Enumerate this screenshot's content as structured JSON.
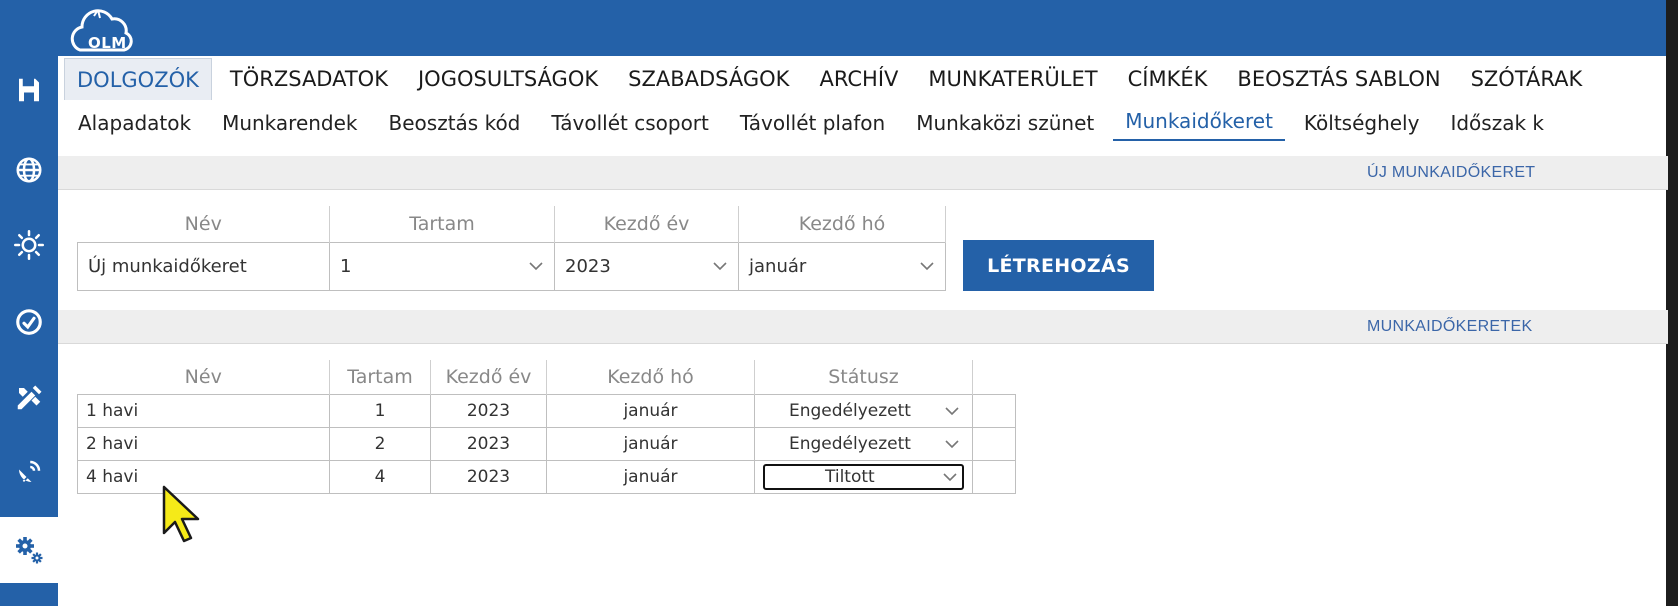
{
  "app": {
    "logo_text": "OLM"
  },
  "sidebar": {
    "items": [
      {
        "icon": "save-icon"
      },
      {
        "icon": "globe-icon"
      },
      {
        "icon": "sun-icon"
      },
      {
        "icon": "clock-icon"
      },
      {
        "icon": "tools-icon"
      },
      {
        "icon": "satellite-dish-icon"
      },
      {
        "icon": "gears-icon",
        "active": true
      }
    ]
  },
  "tabs": [
    {
      "label": "DOLGOZÓK",
      "active": true
    },
    {
      "label": "TÖRZSADATOK"
    },
    {
      "label": "JOGOSULTSÁGOK"
    },
    {
      "label": "SZABADSÁGOK"
    },
    {
      "label": "ARCHÍV"
    },
    {
      "label": "MUNKATERÜLET"
    },
    {
      "label": "CÍMKÉK"
    },
    {
      "label": "BEOSZTÁS SABLON"
    },
    {
      "label": "SZÓTÁRAK"
    }
  ],
  "subtabs": [
    {
      "label": "Alapadatok"
    },
    {
      "label": "Munkarendek"
    },
    {
      "label": "Beosztás kód"
    },
    {
      "label": "Távollét csoport"
    },
    {
      "label": "Távollét plafon"
    },
    {
      "label": "Munkaközi szünet"
    },
    {
      "label": "Munkaidőkeret",
      "active": true
    },
    {
      "label": "Költséghely"
    },
    {
      "label": "Időszak k"
    }
  ],
  "new_section": {
    "title": "ÚJ MUNKAIDŐKERET",
    "headers": [
      "Név",
      "Tartam",
      "Kezdő év",
      "Kezdő hó"
    ],
    "name_value": "Új munkaidőkeret",
    "duration_value": "1",
    "start_year_value": "2023",
    "start_month_value": "január",
    "create_label": "LÉTREHOZÁS"
  },
  "list_section": {
    "title": "MUNKAIDŐKERETEK",
    "headers": [
      "Név",
      "Tartam",
      "Kezdő év",
      "Kezdő hó",
      "Státusz",
      ""
    ],
    "rows": [
      {
        "name": "1 havi",
        "duration": "1",
        "year": "2023",
        "month": "január",
        "status": "Engedélyezett"
      },
      {
        "name": "2 havi",
        "duration": "2",
        "year": "2023",
        "month": "január",
        "status": "Engedélyezett"
      },
      {
        "name": "4 havi",
        "duration": "4",
        "year": "2023",
        "month": "január",
        "status": "Tiltott"
      }
    ]
  },
  "colors": {
    "brand": "#2461a8",
    "section_bg": "#eeeeee",
    "section_title": "#3b66a8"
  }
}
